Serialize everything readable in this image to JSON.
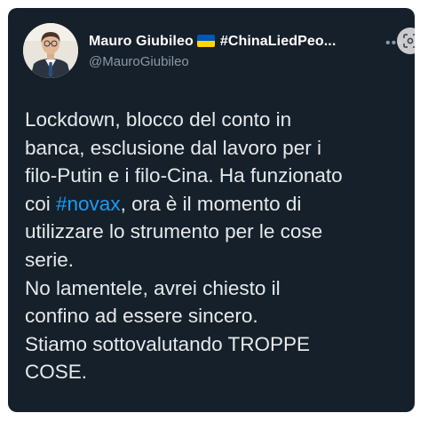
{
  "tweet": {
    "author_name": "Mauro Giubileo",
    "author_flag": "ukraine-flag-emoji",
    "author_name_suffix": "#ChinaLiedPeo...",
    "handle": "@MauroGiubileo",
    "text_lines": [
      [
        "Lockdown, blocco del conto in"
      ],
      [
        "banca, esclusione dal lavoro per i"
      ],
      [
        "filo-Putin e i filo-Cina. Ha funzionato"
      ],
      [
        "coi ",
        "#novax",
        ", ora è il momento di"
      ],
      [
        "utilizzare lo strumento per le cose"
      ],
      [
        "serie."
      ],
      [
        "No lamentele, avrei chiesto il"
      ],
      [
        "confino ad essere sincero."
      ],
      [
        "Stiamo sottovalutando TROPPE"
      ],
      [
        "COSE."
      ]
    ],
    "hashtag": "#novax"
  },
  "icons": {
    "more": "more-options-icon",
    "lens": "visual-search-icon"
  },
  "colors": {
    "card_background": "#15202b",
    "text": "#e7e9ea",
    "secondary_text": "#8b98a5",
    "hashtag": "#1d9bf0",
    "flag_blue": "#0057b7",
    "flag_yellow": "#ffd700"
  }
}
